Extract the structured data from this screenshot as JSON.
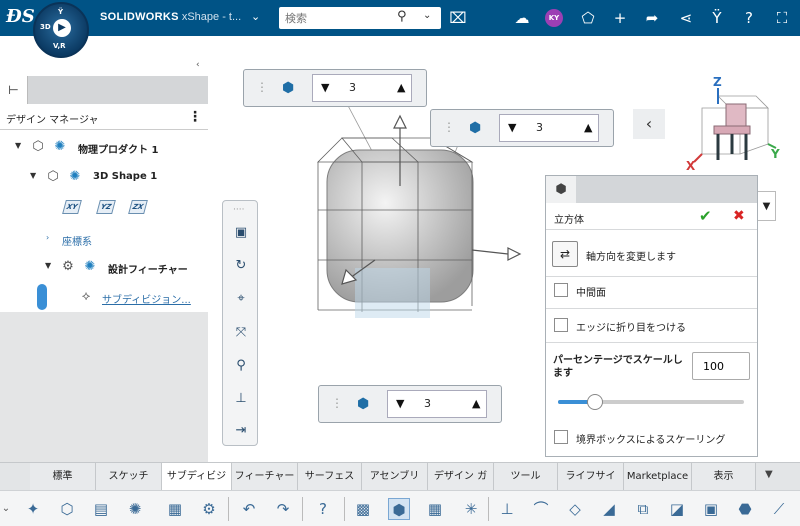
{
  "topbar": {
    "brand": "SOLIDWORKS",
    "app_name": "xShape - t...",
    "compass_n": "3D",
    "compass_v": "V,R",
    "compass_top": "Ϋ",
    "search_placeholder": "検索",
    "avatar_initials": "KY",
    "icons": [
      "tag-icon",
      "cloud-icon",
      "share-icon",
      "plus-icon",
      "forward-icon",
      "network-icon",
      "tools-icon",
      "help-icon",
      "fullscreen-icon"
    ]
  },
  "left_panel": {
    "header": "デザイン マネージャ",
    "tree": {
      "physical_product": "物理プロダクト 1",
      "shape": "3D Shape 1",
      "planes": [
        "XY",
        "YZ",
        "ZX"
      ],
      "coord": "座標系",
      "features": "設計フィーチャー",
      "subdiv": "サブディビジョン..."
    }
  },
  "spinners": {
    "top": "3",
    "right": "3",
    "bottom": "3"
  },
  "triad": {
    "x": "X",
    "y": "Y",
    "z": "Z"
  },
  "property_panel": {
    "title": "立方体",
    "reverse_label": "軸方向を変更します",
    "mid_plane": "中間面",
    "crease_edges": "エッジに折り目をつける",
    "scale_percent_label": "パーセンテージでスケールします",
    "scale_percent_value": "100",
    "slider_fraction": 0.2,
    "bbox_scaling": "境界ボックスによるスケーリング"
  },
  "bottom_tabs": [
    "標準",
    "スケッチ",
    "サブディビジ",
    "フィーチャー",
    "サーフェス",
    "アセンブリ",
    "デザイン ガ",
    "ツール",
    "ライフサイ",
    "Marketplace",
    "表示"
  ],
  "colors": {
    "topbar": "#005386",
    "accent": "#3a8fd6",
    "ok": "#2aa12a",
    "cancel": "#d92424"
  }
}
